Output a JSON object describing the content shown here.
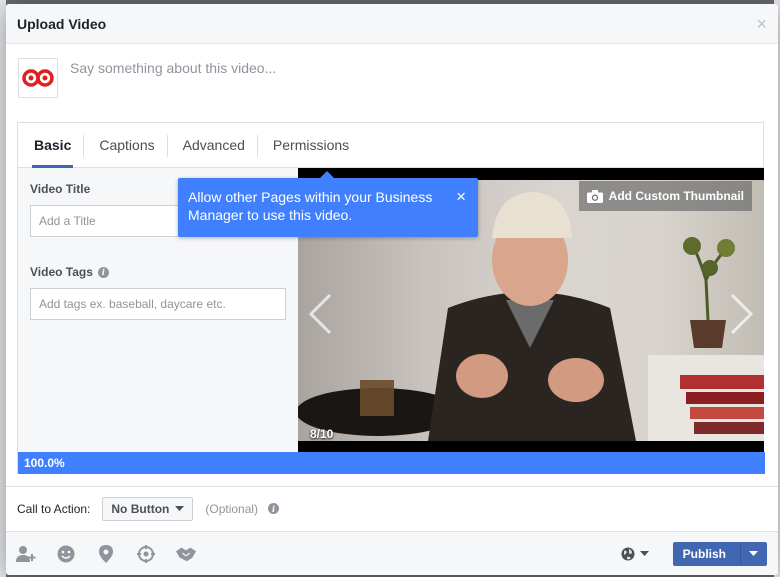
{
  "dialog": {
    "title": "Upload Video",
    "close_glyph": "×"
  },
  "composer": {
    "placeholder": "Say something about this video..."
  },
  "tabs": [
    {
      "label": "Basic",
      "active": true
    },
    {
      "label": "Captions",
      "active": false
    },
    {
      "label": "Advanced",
      "active": false
    },
    {
      "label": "Permissions",
      "active": false
    }
  ],
  "form": {
    "title_label": "Video Title",
    "title_placeholder": "Add a Title",
    "tags_label": "Video Tags",
    "tags_placeholder": "Add tags ex. baseball, daycare etc."
  },
  "tooltip": {
    "text": "Allow other Pages within your Business Manager to use this video.",
    "close_glyph": "×"
  },
  "video": {
    "custom_thumbnail_label": "Add Custom Thumbnail",
    "counter": "8/10"
  },
  "upload": {
    "progress_label": "100.0%",
    "progress": 1.0
  },
  "cta": {
    "label": "Call to Action:",
    "selected": "No Button",
    "optional": "(Optional)"
  },
  "footer": {
    "icons": [
      "tag-people-icon",
      "feeling-icon",
      "location-icon",
      "target-icon",
      "handshake-icon"
    ],
    "audience_icon": "globe-icon",
    "publish_label": "Publish"
  },
  "colors": {
    "accent": "#4267b2",
    "tooltip": "#4080ff",
    "progress": "#4080ff"
  }
}
